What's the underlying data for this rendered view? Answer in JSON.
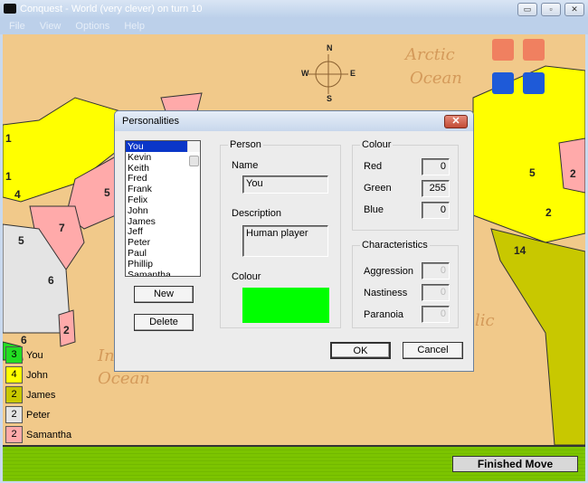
{
  "window": {
    "title": "Conquest - World (very clever) on turn 10",
    "minimize": "▭",
    "maximize": "▫",
    "close": "✕"
  },
  "menu": [
    "File",
    "View",
    "Options",
    "Help"
  ],
  "map": {
    "oceans": [
      "Arctic",
      "Ocean",
      "In",
      "Ocean",
      "lic"
    ],
    "compass": {
      "n": "N",
      "s": "S",
      "w": "W",
      "e": "E"
    },
    "territory_numbers": [
      "1",
      "1",
      "4",
      "5",
      "7",
      "5",
      "6",
      "2",
      "6",
      "5",
      "2",
      "2",
      "14"
    ],
    "dice_colors": [
      "#f08060",
      "#1e5ad8"
    ]
  },
  "players": [
    {
      "name": "You",
      "count": "3",
      "color": "#22dd22"
    },
    {
      "name": "John",
      "count": "4",
      "color": "#ffff00"
    },
    {
      "name": "James",
      "count": "2",
      "color": "#c8c800"
    },
    {
      "name": "Peter",
      "count": "2",
      "color": "#e4e4e4"
    },
    {
      "name": "Samantha",
      "count": "2",
      "color": "#ffaaaa"
    }
  ],
  "finished_move": "Finished Move",
  "dialog": {
    "title": "Personalities",
    "close": "✕",
    "people": [
      "You",
      "Kevin",
      "Keith",
      "Fred",
      "Frank",
      "Felix",
      "John",
      "James",
      "Jeff",
      "Peter",
      "Paul",
      "Phillip",
      "Samantha"
    ],
    "selected": "You",
    "new": "New",
    "delete": "Delete",
    "person": {
      "group": "Person",
      "name_label": "Name",
      "name": "You",
      "description_label": "Description",
      "description": "Human player",
      "colour_label": "Colour",
      "colour": "#00ff00"
    },
    "colour": {
      "group": "Colour",
      "red_label": "Red",
      "red": "0",
      "green_label": "Green",
      "green": "255",
      "blue_label": "Blue",
      "blue": "0"
    },
    "characteristics": {
      "group": "Characteristics",
      "aggression_label": "Aggression",
      "aggression": "0",
      "nastiness_label": "Nastiness",
      "nastiness": "0",
      "paranoia_label": "Paranoia",
      "paranoia": "0"
    },
    "ok": "OK",
    "cancel": "Cancel"
  }
}
